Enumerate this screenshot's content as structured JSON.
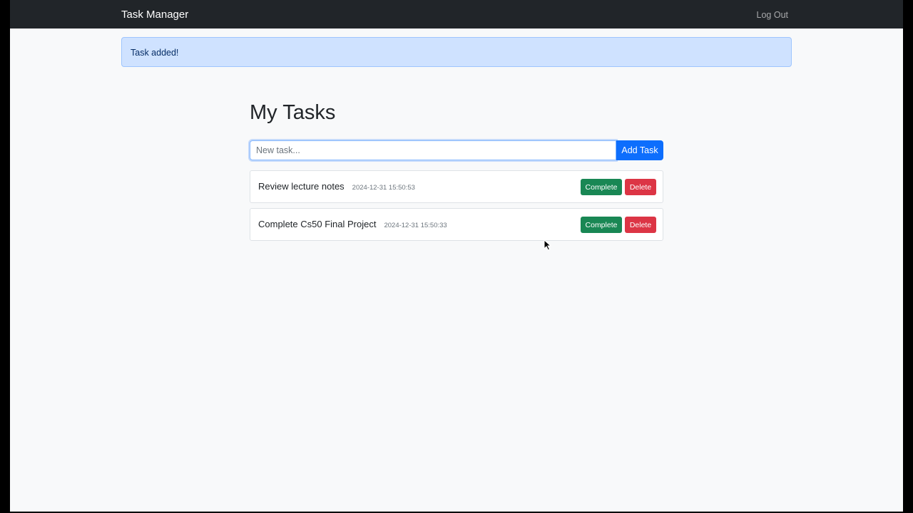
{
  "navbar": {
    "brand": "Task Manager",
    "logout_label": "Log Out"
  },
  "alert": {
    "message": "Task added!"
  },
  "main": {
    "title": "My Tasks",
    "new_task": {
      "value": "",
      "placeholder": "New task...",
      "add_label": "Add Task"
    },
    "tasks": [
      {
        "text": "Review lecture notes",
        "timestamp": "2024-12-31 15:50:53",
        "complete_label": "Complete",
        "delete_label": "Delete"
      },
      {
        "text": "Complete Cs50 Final Project",
        "timestamp": "2024-12-31 15:50:33",
        "complete_label": "Complete",
        "delete_label": "Delete"
      }
    ]
  },
  "colors": {
    "navbar_bg": "#212529",
    "page_bg": "#f8f9fa",
    "primary": "#0d6efd",
    "success": "#198754",
    "danger": "#dc3545",
    "alert_bg": "#cfe2ff"
  },
  "icons": {
    "cursor": "mouse-pointer-icon"
  }
}
